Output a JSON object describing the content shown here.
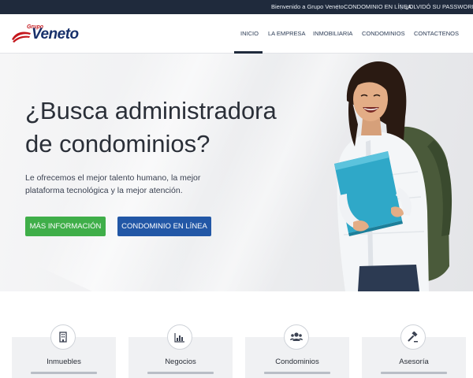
{
  "topbar": {
    "welcome": "Bienvenido a Grupo Veneto",
    "separator": "|",
    "condominio_link": "CONDOMINIO EN LÍNEA",
    "password_link": "¿OLVIDÓ SU PASSWORD?"
  },
  "logo": {
    "grupo": "Grupo",
    "veneto": "Veneto"
  },
  "nav": {
    "active": "INICIO",
    "items": [
      "INICIO",
      "LA EMPRESA",
      "INMOBILIARIA",
      "CONDOMINIOS",
      "CONTACTENOS"
    ]
  },
  "hero": {
    "title_line1": "¿Busca administradora",
    "title_line2": "de condominios?",
    "subtitle_line1": "Le ofrecemos el mejor talento humano, la mejor",
    "subtitle_line2": "plataforma tecnológica y la mejor atención.",
    "btn_info": "MÁS INFORMACIÓN",
    "btn_condo": "CONDOMINIO EN LÍNEA"
  },
  "features": [
    {
      "title": "Inmuebles",
      "icon": "building-icon"
    },
    {
      "title": "Negocios",
      "icon": "bar-chart-icon"
    },
    {
      "title": "Condominios",
      "icon": "users-icon"
    },
    {
      "title": "Asesoría",
      "icon": "gavel-icon"
    }
  ],
  "colors": {
    "topbar": "#1f2a3c",
    "nav_text": "#2b3b55",
    "btn_green": "#3fae49",
    "btn_blue": "#2257a6",
    "logo_blue": "#17306b",
    "logo_red": "#c4161c"
  }
}
